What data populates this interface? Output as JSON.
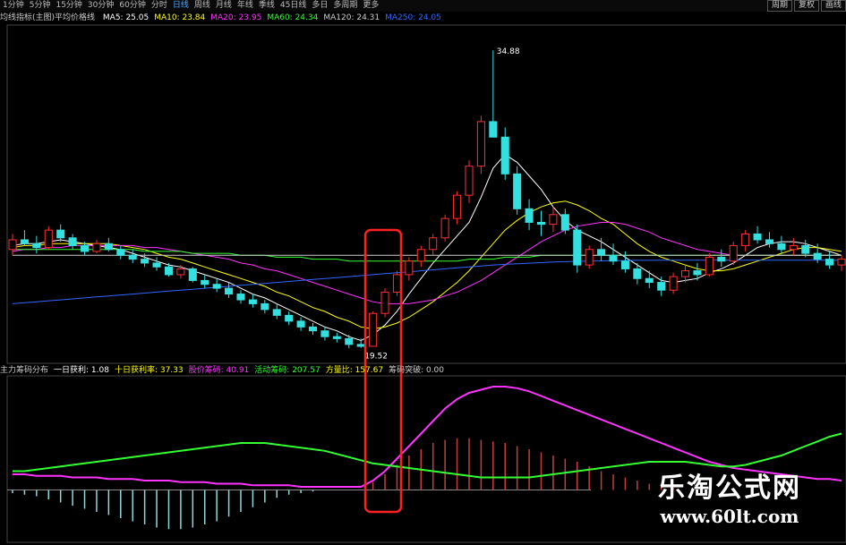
{
  "toolbar": {
    "tabs": [
      "1分钟",
      "5分钟",
      "15分钟",
      "30分钟",
      "60分钟",
      "分时",
      "日线",
      "周线",
      "月线",
      "年线",
      "季线",
      "45日线",
      "多日",
      "多周期",
      "更多"
    ],
    "active_tab": "日线",
    "right_buttons": [
      "周期",
      "复权",
      "画线"
    ]
  },
  "ma_legend": {
    "name": "均线指标(主图)平均价格线",
    "items": [
      {
        "label": "MA5: 25.05",
        "color": "#ffffff"
      },
      {
        "label": "MA10: 23.84",
        "color": "#ffff00"
      },
      {
        "label": "MA20: 23.95",
        "color": "#ff33ff"
      },
      {
        "label": "MA60: 24.34",
        "color": "#33ff33"
      },
      {
        "label": "MA120: 24.31",
        "color": "#cccccc"
      },
      {
        "label": "MA250: 24.05",
        "color": "#3366ff"
      }
    ]
  },
  "sub_legend": {
    "items": [
      {
        "label": "主力筹码分布",
        "color": "#cccccc"
      },
      {
        "label": "一日获利: 1.08",
        "color": "#ffffff"
      },
      {
        "label": "十日获利率: 37.33",
        "color": "#ffff00"
      },
      {
        "label": "股价筹码: 40.91",
        "color": "#ff33ff"
      },
      {
        "label": "活动筹码: 207.57",
        "color": "#33ff33"
      },
      {
        "label": "方量比: 157.67",
        "color": "#ffff00"
      },
      {
        "label": "筹码突破: 0.00",
        "color": "#cccccc"
      }
    ]
  },
  "watermark": {
    "title": "乐淘公式网",
    "url": "www.60lt.com"
  },
  "chart_data": [
    {
      "type": "candlestick",
      "ohlc": [
        [
          24.6,
          25.4,
          24.3,
          25.1
        ],
        [
          25.1,
          25.6,
          24.8,
          24.9
        ],
        [
          24.9,
          25.3,
          24.4,
          24.7
        ],
        [
          24.7,
          25.8,
          24.6,
          25.6
        ],
        [
          25.6,
          25.9,
          25.0,
          25.2
        ],
        [
          25.2,
          25.4,
          24.6,
          24.8
        ],
        [
          24.8,
          25.0,
          24.3,
          24.5
        ],
        [
          24.5,
          25.1,
          24.4,
          24.9
        ],
        [
          24.9,
          25.2,
          24.5,
          24.6
        ],
        [
          24.6,
          24.8,
          24.1,
          24.3
        ],
        [
          24.3,
          24.6,
          23.9,
          24.1
        ],
        [
          24.1,
          24.4,
          23.7,
          23.9
        ],
        [
          23.9,
          24.2,
          23.5,
          23.7
        ],
        [
          23.7,
          23.9,
          23.2,
          23.3
        ],
        [
          23.3,
          23.8,
          23.1,
          23.6
        ],
        [
          23.6,
          23.7,
          22.9,
          23.0
        ],
        [
          23.0,
          23.3,
          22.6,
          22.8
        ],
        [
          22.8,
          23.1,
          22.4,
          22.6
        ],
        [
          22.6,
          22.9,
          22.1,
          22.3
        ],
        [
          22.3,
          22.5,
          21.8,
          22.0
        ],
        [
          22.0,
          22.3,
          21.6,
          21.8
        ],
        [
          21.8,
          22.0,
          21.3,
          21.5
        ],
        [
          21.5,
          21.8,
          21.0,
          21.2
        ],
        [
          21.2,
          21.4,
          20.7,
          20.9
        ],
        [
          20.9,
          21.1,
          20.4,
          20.6
        ],
        [
          20.6,
          20.8,
          20.2,
          20.4
        ],
        [
          20.4,
          20.6,
          19.9,
          20.1
        ],
        [
          20.1,
          20.3,
          19.8,
          20.0
        ],
        [
          20.0,
          20.2,
          19.5,
          19.7
        ],
        [
          19.7,
          20.0,
          19.52,
          19.6
        ],
        [
          19.6,
          21.4,
          19.6,
          21.3
        ],
        [
          21.3,
          22.6,
          21.1,
          22.4
        ],
        [
          22.4,
          23.5,
          22.2,
          23.3
        ],
        [
          23.3,
          24.2,
          23.0,
          24.0
        ],
        [
          24.0,
          24.8,
          23.7,
          24.6
        ],
        [
          24.6,
          25.4,
          24.3,
          25.2
        ],
        [
          25.2,
          26.4,
          25.0,
          26.2
        ],
        [
          26.2,
          27.6,
          25.9,
          27.4
        ],
        [
          27.4,
          29.2,
          27.0,
          28.9
        ],
        [
          28.9,
          31.5,
          28.5,
          31.2
        ],
        [
          31.2,
          34.88,
          30.8,
          30.4
        ],
        [
          30.4,
          30.9,
          28.2,
          28.5
        ],
        [
          28.5,
          28.9,
          26.4,
          26.7
        ],
        [
          26.7,
          27.2,
          25.6,
          26.0
        ],
        [
          26.0,
          26.6,
          25.3,
          25.9
        ],
        [
          25.9,
          26.8,
          25.5,
          26.4
        ],
        [
          26.4,
          26.7,
          25.4,
          25.6
        ],
        [
          25.6,
          25.9,
          23.4,
          23.8
        ],
        [
          23.8,
          24.8,
          23.6,
          24.6
        ],
        [
          24.6,
          25.2,
          24.0,
          24.3
        ],
        [
          24.3,
          24.9,
          23.8,
          24.0
        ],
        [
          24.0,
          24.5,
          23.4,
          23.6
        ],
        [
          23.6,
          23.9,
          22.8,
          23.1
        ],
        [
          23.1,
          23.5,
          22.6,
          22.9
        ],
        [
          22.9,
          23.2,
          22.2,
          22.5
        ],
        [
          22.5,
          23.4,
          22.3,
          23.2
        ],
        [
          23.2,
          23.8,
          22.9,
          23.5
        ],
        [
          23.5,
          23.9,
          23.0,
          23.3
        ],
        [
          23.3,
          24.4,
          23.2,
          24.2
        ],
        [
          24.2,
          24.6,
          23.7,
          24.0
        ],
        [
          24.0,
          25.0,
          23.8,
          24.8
        ],
        [
          24.8,
          25.6,
          24.5,
          25.4
        ],
        [
          25.4,
          25.8,
          24.9,
          25.1
        ],
        [
          25.1,
          25.5,
          24.7,
          24.9
        ],
        [
          24.9,
          25.3,
          24.4,
          24.6
        ],
        [
          24.6,
          25.2,
          24.3,
          24.8
        ],
        [
          24.8,
          25.1,
          24.2,
          24.4
        ],
        [
          24.4,
          24.9,
          23.9,
          24.1
        ],
        [
          24.1,
          24.5,
          23.6,
          23.8
        ],
        [
          23.8,
          24.3,
          23.5,
          24.1
        ]
      ],
      "annotations": [
        {
          "label": "34.88",
          "index": 40
        },
        {
          "label": "19.52",
          "index": 29
        }
      ],
      "ma_series": [
        {
          "name": "MA5",
          "color": "#ffffff",
          "values": [
            24.8,
            24.9,
            24.9,
            25.0,
            25.1,
            25.0,
            24.9,
            24.8,
            24.7,
            24.6,
            24.4,
            24.2,
            24.0,
            23.8,
            23.7,
            23.5,
            23.3,
            23.1,
            22.9,
            22.6,
            22.3,
            22.1,
            21.8,
            21.5,
            21.2,
            20.9,
            20.6,
            20.4,
            20.1,
            19.9,
            20.2,
            20.7,
            21.4,
            22.3,
            23.1,
            23.9,
            24.6,
            25.3,
            26.0,
            27.3,
            28.8,
            29.5,
            29.1,
            28.4,
            27.7,
            26.8,
            26.1,
            25.6,
            25.3,
            25.0,
            24.6,
            24.2,
            23.8,
            23.4,
            23.0,
            22.9,
            23.0,
            23.1,
            23.4,
            23.6,
            23.9,
            24.3,
            24.7,
            24.9,
            25.0,
            25.0,
            24.9,
            24.7,
            24.5,
            24.3
          ]
        },
        {
          "name": "MA10",
          "color": "#ffff00",
          "values": [
            24.7,
            24.8,
            24.8,
            24.9,
            24.9,
            24.9,
            24.9,
            24.9,
            24.9,
            24.8,
            24.7,
            24.6,
            24.4,
            24.2,
            24.1,
            23.9,
            23.7,
            23.5,
            23.3,
            23.1,
            22.9,
            22.7,
            22.4,
            22.2,
            21.9,
            21.6,
            21.4,
            21.1,
            20.9,
            20.6,
            20.5,
            20.6,
            20.8,
            21.1,
            21.5,
            21.9,
            22.4,
            22.9,
            23.5,
            24.2,
            24.9,
            25.6,
            26.1,
            26.5,
            26.8,
            27.0,
            27.1,
            26.9,
            26.6,
            26.2,
            25.9,
            25.4,
            24.9,
            24.5,
            24.2,
            24.0,
            23.8,
            23.6,
            23.5,
            23.5,
            23.6,
            23.8,
            24.0,
            24.2,
            24.4,
            24.6,
            24.7,
            24.7,
            24.6,
            24.5
          ]
        },
        {
          "name": "MA20",
          "color": "#ff33ff",
          "values": [
            24.5,
            24.6,
            24.6,
            24.7,
            24.7,
            24.8,
            24.8,
            24.8,
            24.8,
            24.8,
            24.8,
            24.7,
            24.7,
            24.6,
            24.5,
            24.4,
            24.3,
            24.2,
            24.1,
            23.9,
            23.8,
            23.6,
            23.5,
            23.3,
            23.1,
            22.9,
            22.7,
            22.5,
            22.3,
            22.1,
            21.9,
            21.8,
            21.8,
            21.8,
            21.9,
            22.0,
            22.2,
            22.4,
            22.7,
            23.0,
            23.4,
            23.8,
            24.2,
            24.6,
            25.0,
            25.3,
            25.6,
            25.8,
            25.9,
            26.0,
            26.0,
            25.9,
            25.7,
            25.5,
            25.2,
            25.0,
            24.8,
            24.6,
            24.5,
            24.4,
            24.3,
            24.3,
            24.3,
            24.3,
            24.3,
            24.3,
            24.3,
            24.3,
            24.3,
            24.3
          ]
        },
        {
          "name": "MA60",
          "color": "#33ff33",
          "values": [
            24.6,
            24.6,
            24.6,
            24.6,
            24.6,
            24.6,
            24.6,
            24.6,
            24.6,
            24.6,
            24.6,
            24.5,
            24.5,
            24.5,
            24.5,
            24.4,
            24.4,
            24.4,
            24.4,
            24.3,
            24.3,
            24.3,
            24.2,
            24.2,
            24.2,
            24.1,
            24.1,
            24.1,
            24.0,
            24.0,
            24.0,
            24.0,
            24.0,
            24.0,
            24.0,
            24.0,
            24.0,
            24.0,
            24.1,
            24.1,
            24.1,
            24.2,
            24.2,
            24.2,
            24.3,
            24.3,
            24.3,
            24.3,
            24.3,
            24.3,
            24.3,
            24.3,
            24.3,
            24.3,
            24.3,
            24.3,
            24.3,
            24.3,
            24.3,
            24.3,
            24.3,
            24.3,
            24.3,
            24.3,
            24.3,
            24.3,
            24.3,
            24.3,
            24.3,
            24.3
          ]
        },
        {
          "name": "MA120",
          "color": "#cccccc",
          "values": [
            24.3,
            24.3,
            24.3,
            24.3,
            24.3,
            24.3,
            24.3,
            24.3,
            24.3,
            24.3,
            24.3,
            24.3,
            24.3,
            24.3,
            24.3,
            24.3,
            24.3,
            24.3,
            24.3,
            24.3,
            24.3,
            24.3,
            24.3,
            24.3,
            24.3,
            24.3,
            24.3,
            24.3,
            24.3,
            24.3,
            24.3,
            24.3,
            24.3,
            24.3,
            24.3,
            24.3,
            24.3,
            24.3,
            24.3,
            24.3,
            24.3,
            24.3,
            24.3,
            24.3,
            24.3,
            24.3,
            24.3,
            24.3,
            24.3,
            24.3,
            24.3,
            24.3,
            24.3,
            24.3,
            24.3,
            24.3,
            24.3,
            24.3,
            24.3,
            24.3,
            24.3,
            24.3,
            24.3,
            24.3,
            24.3,
            24.3,
            24.3,
            24.3,
            24.3,
            24.3
          ]
        },
        {
          "name": "MA250",
          "color": "#3366ff",
          "values": [
            21.8,
            21.85,
            21.9,
            21.95,
            22.0,
            22.05,
            22.1,
            22.15,
            22.2,
            22.25,
            22.3,
            22.35,
            22.4,
            22.45,
            22.5,
            22.55,
            22.6,
            22.65,
            22.7,
            22.75,
            22.8,
            22.85,
            22.9,
            22.95,
            23.0,
            23.05,
            23.1,
            23.15,
            23.2,
            23.25,
            23.3,
            23.35,
            23.4,
            23.45,
            23.5,
            23.55,
            23.6,
            23.65,
            23.7,
            23.75,
            23.8,
            23.83,
            23.86,
            23.89,
            23.92,
            23.95,
            23.97,
            23.99,
            24.0,
            24.01,
            24.02,
            24.03,
            24.04,
            24.04,
            24.05,
            24.05,
            24.05,
            24.05,
            24.05,
            24.05,
            24.05,
            24.05,
            24.05,
            24.05,
            24.05,
            24.05,
            24.05,
            24.05,
            24.05,
            24.05
          ]
        }
      ],
      "ylim": [
        19.0,
        36.0
      ]
    },
    {
      "type": "bar",
      "series": [
        {
          "name": "股价筹码",
          "color": "#ff33ff",
          "values": [
            10,
            10,
            9,
            9,
            9,
            8,
            8,
            8,
            7,
            7,
            7,
            6,
            6,
            6,
            5,
            5,
            5,
            4,
            4,
            4,
            3,
            3,
            3,
            3,
            2,
            2,
            2,
            2,
            2,
            2,
            6,
            12,
            20,
            28,
            36,
            44,
            52,
            58,
            62,
            64,
            66,
            66,
            65,
            63,
            60,
            57,
            54,
            51,
            48,
            45,
            42,
            39,
            36,
            33,
            30,
            27,
            24,
            21,
            18,
            16,
            14,
            13,
            12,
            11,
            10,
            9,
            8,
            7,
            7,
            6
          ]
        },
        {
          "name": "活动筹码",
          "color": "#33ff33",
          "values": [
            12,
            12,
            13,
            14,
            15,
            16,
            17,
            18,
            19,
            20,
            21,
            22,
            23,
            24,
            25,
            26,
            27,
            28,
            29,
            30,
            30,
            30,
            29,
            28,
            27,
            26,
            25,
            23,
            21,
            19,
            17,
            16,
            15,
            14,
            13,
            12,
            11,
            10,
            9,
            8,
            8,
            8,
            8,
            8,
            9,
            10,
            11,
            12,
            13,
            14,
            15,
            16,
            17,
            18,
            18,
            18,
            18,
            17,
            16,
            15,
            15,
            16,
            18,
            20,
            22,
            25,
            28,
            31,
            34,
            36
          ]
        },
        {
          "name": "一日获利",
          "color": "#cccccc",
          "values": [
            -2,
            -3,
            -4,
            -6,
            -8,
            -10,
            -12,
            -14,
            -16,
            -18,
            -20,
            -22,
            -24,
            -25,
            -25,
            -24,
            -22,
            -20,
            -17,
            -14,
            -11,
            -8,
            -5,
            -3,
            -2,
            -1,
            0,
            0,
            0,
            0,
            5,
            10,
            16,
            22,
            26,
            30,
            32,
            33,
            33,
            32,
            31,
            30,
            28,
            26,
            24,
            22,
            20,
            18,
            15,
            12,
            10,
            8,
            6,
            4,
            2,
            1,
            0,
            0,
            0,
            0,
            0,
            0,
            0,
            0,
            0,
            0,
            0,
            0,
            0,
            0
          ]
        }
      ],
      "ylim": [
        -30,
        70
      ]
    }
  ]
}
